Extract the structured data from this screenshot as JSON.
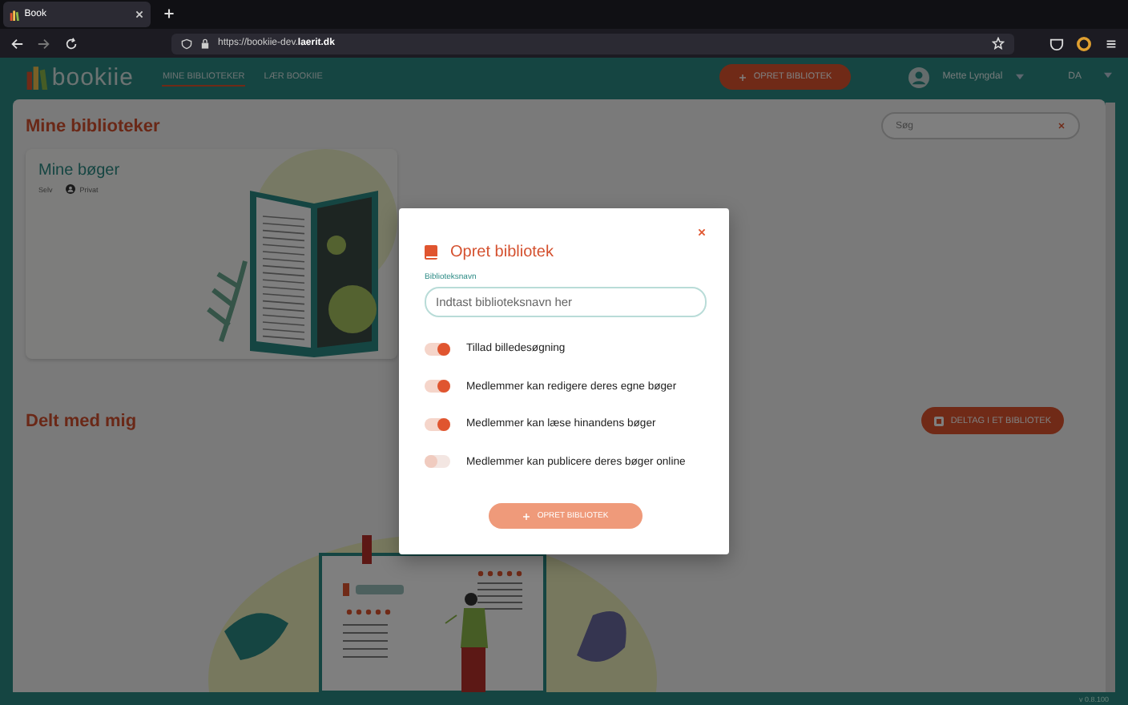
{
  "browser": {
    "tab_title": "Book",
    "url": "https://bookiie-dev.**laerit.dk**"
  },
  "header": {
    "logo": "bookiie",
    "nav": [
      {
        "label": "MINE BIBLIOTEKER",
        "selected": true
      },
      {
        "label": "LÆR BOOKIIE",
        "selected": false
      }
    ],
    "create_button": "OPRET BIBLIOTEK",
    "user": "Mette Lyngdal",
    "language": "DA"
  },
  "main": {
    "my_title": "Mine biblioteker",
    "search": {
      "placeholder": "Søg"
    },
    "libraries": [
      {
        "title": "Mine bøger",
        "owner": "Selv",
        "visibility": "Privat"
      }
    ],
    "shared_title": "Delt med mig",
    "join_button": "DELTAG I ET BIBLIOTEK",
    "version": "v 0.8.100"
  },
  "dialog": {
    "title": "Opret bibliotek",
    "field_label": "Biblioteksnavn",
    "placeholder": "Indtast biblioteksnavn her",
    "options": [
      {
        "label": "Tillad billedesøgning",
        "on": true
      },
      {
        "label": "Medlemmer kan redigere deres egne bøger",
        "on": true
      },
      {
        "label": "Medlemmer kan læse hinandens bøger",
        "on": true
      },
      {
        "label": "Medlemmer kan publicere deres bøger online",
        "on": false
      }
    ],
    "submit": "OPRET BIBLIOTEK"
  }
}
